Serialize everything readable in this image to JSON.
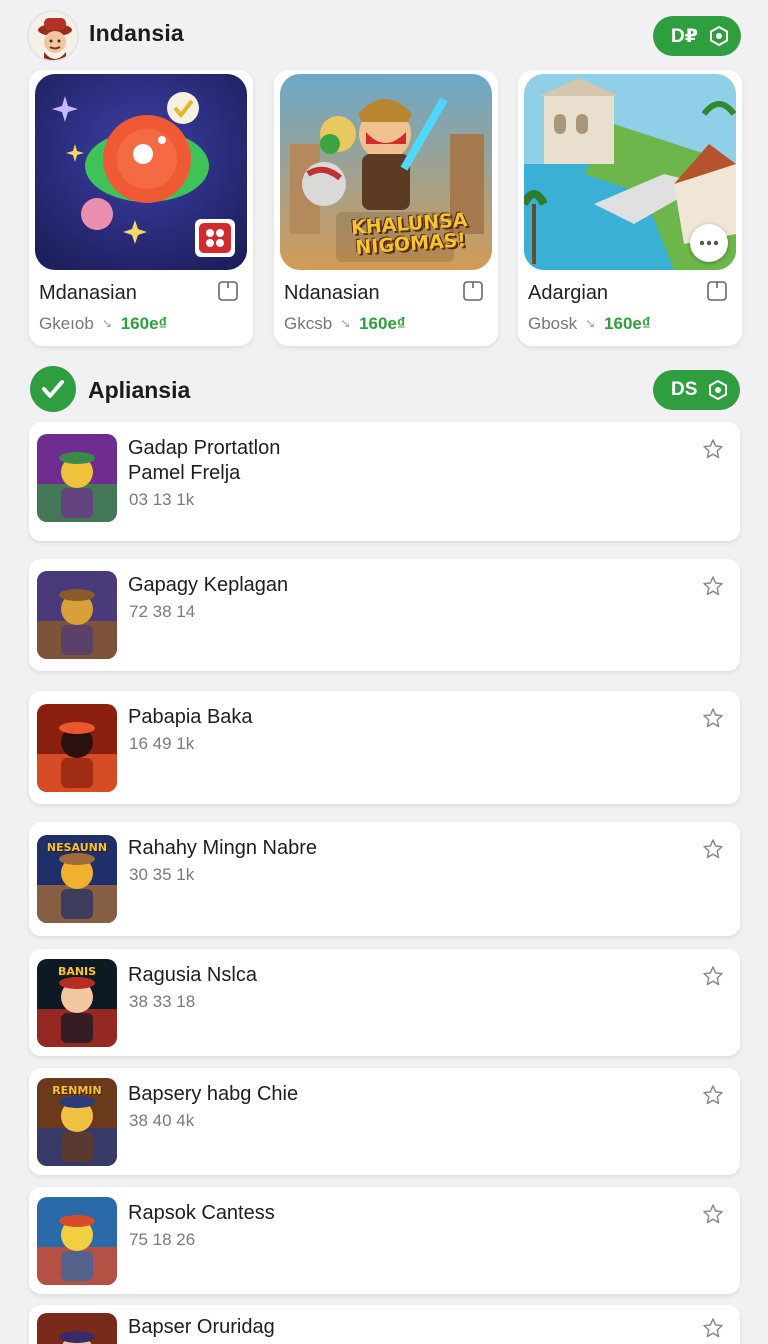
{
  "header": {
    "title": "Indansia",
    "badge_label": "D₽"
  },
  "featured": [
    {
      "name": "Mdanasian",
      "meta_left": "Gkeıob",
      "price": "160e₫",
      "art_text": ""
    },
    {
      "name": "Ndanasian",
      "meta_left": "Gkcsb",
      "price": "160e₫",
      "art_text": "KHALUNSA NIGOMAS!"
    },
    {
      "name": "Adargian",
      "meta_left": "Gbosk",
      "price": "160e₫",
      "art_text": ""
    }
  ],
  "section": {
    "title": "Apliansia",
    "badge_label": "DS"
  },
  "items": [
    {
      "title": "Gadap Prortatlon\nPamel Frelja",
      "meta": "03  13 1k",
      "thumb_text": ""
    },
    {
      "title": "Gapagy Keplagan",
      "meta": "72  38 14",
      "thumb_text": ""
    },
    {
      "title": "Pabapia  Baka",
      "meta": "16  49 1k",
      "thumb_text": ""
    },
    {
      "title": "Rahahy Mingn Nabre",
      "meta": "30  35 1k",
      "thumb_text": "NESAUNN"
    },
    {
      "title": "Ragusia Nslca",
      "meta": "38  33 18",
      "thumb_text": "BANIS"
    },
    {
      "title": "Bapsery habg Chie",
      "meta": "38  40 4k",
      "thumb_text": "RENMIN"
    },
    {
      "title": "Rapsok Cantess",
      "meta": "75  18 26",
      "thumb_text": ""
    },
    {
      "title": "Bapser Oruridag",
      "meta": "",
      "thumb_text": ""
    }
  ],
  "colors": {
    "accent": "#2f9e3e",
    "background": "#f1f1f3"
  }
}
